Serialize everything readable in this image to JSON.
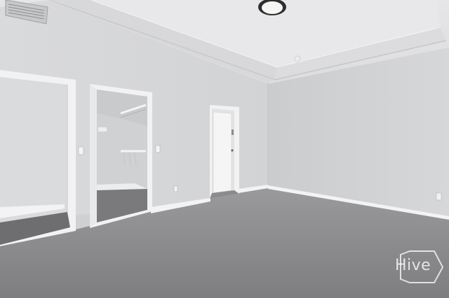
{
  "watermark": {
    "text": "Hive"
  },
  "colors": {
    "left_wall": "#d6d7d9",
    "right_wall": "#d1d2d4",
    "ceiling": "#e3e3e5",
    "carpet": "#8c8c8e",
    "trim": "#f4f4f4"
  }
}
